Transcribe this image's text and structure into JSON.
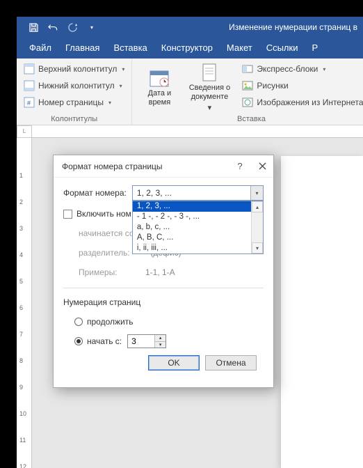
{
  "titlebar": {
    "doc_title": "Изменение нумерации страниц в"
  },
  "menu": {
    "file": "Файл",
    "home": "Главная",
    "insert": "Вставка",
    "design": "Конструктор",
    "layout": "Макет",
    "references": "Ссылки",
    "r": "Р"
  },
  "ribbon": {
    "group_headers_footers": {
      "header": "Верхний колонтитул",
      "footer": "Нижний колонтитул",
      "page_number": "Номер страницы",
      "label": "Колонтитулы"
    },
    "group_insert": {
      "date_time": "Дата и\nвремя",
      "doc_info": "Сведения о\nдокументе",
      "quick_parts": "Экспресс-блоки",
      "pictures": "Рисунки",
      "online_pictures": "Изображения из Интернета",
      "label": "Вставка"
    }
  },
  "ruler_corner": "L",
  "dialog": {
    "title": "Формат номера страницы",
    "help": "?",
    "format_label": "Формат номера:",
    "combo_value": "1, 2, 3, ...",
    "options": [
      "1, 2, 3, ...",
      "- 1 -, - 2 -, - 3 -, ...",
      "a, b, c, ...",
      "A, B, C, ...",
      "i, ii, iii, ..."
    ],
    "include_chapter_cut": "Включить ном",
    "starts_with_label": "начинается со",
    "separator_label": "разделитель:",
    "separator_value": "-     (дефис)",
    "examples_label": "Примеры:",
    "examples_value": "1-1, 1-A",
    "section_title": "Нумерация страниц",
    "continue_label": "продолжить",
    "start_at_label": "начать с:",
    "start_at_value": "3",
    "ok": "OK",
    "cancel": "Отмена"
  }
}
